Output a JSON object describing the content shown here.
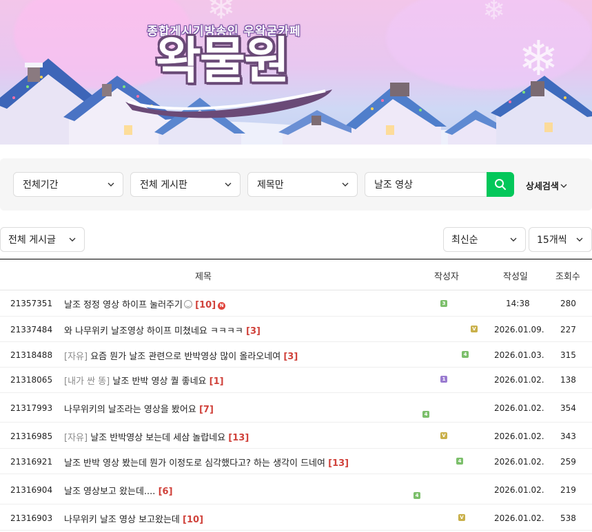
{
  "banner": {
    "tagline": "종합게시기방송인 우왁굳카페",
    "logo_text": "왁물원"
  },
  "search": {
    "period": "전체기간",
    "board": "전체 게시판",
    "scope": "제목만",
    "query": "날조 영상",
    "detail_label": "상세검색"
  },
  "filters": {
    "article_type": "전체 게시글",
    "sort": "최신순",
    "page_size": "15개씩"
  },
  "table": {
    "headers": {
      "title": "제목",
      "author": "작성자",
      "date": "작성일",
      "views": "조회수"
    },
    "rows": [
      {
        "id": "21357351",
        "head": "",
        "title": "날조 정정 영상 하이프 눌러주기",
        "comments": "[10]",
        "badge": "3",
        "badge_color": "#7cbf6b",
        "date": "14:38",
        "views": "280",
        "emoji": true,
        "is_new": true
      },
      {
        "id": "21337484",
        "head": "",
        "title": "와 나무위키 날조영상 하이프 미쳤네요 ㅋㅋㅋㅋ",
        "comments": "[3]",
        "badge": "V",
        "badge_color": "#c9b04a",
        "date": "2026.01.09.",
        "views": "227"
      },
      {
        "id": "21318488",
        "head": "[자유]",
        "title": "요즘 뭔가 날조 관련으로 반박영상 많이 올라오네여",
        "comments": "[3]",
        "badge": "4",
        "badge_color": "#7cbf6b",
        "date": "2026.01.03.",
        "views": "315"
      },
      {
        "id": "21318065",
        "head": "[내가 싼 똥]",
        "title": "날조 반박 영상 퀄 좋네요",
        "comments": "[1]",
        "badge": "1",
        "badge_color": "#9a7bd0",
        "date": "2026.01.02.",
        "views": "138"
      },
      {
        "id": "21317993",
        "head": "",
        "title": "나무위키의 날조라는 영상을 봤어요",
        "comments": "[7]",
        "badge": "4",
        "badge_color": "#7cbf6b",
        "date": "2026.01.02.",
        "views": "354"
      },
      {
        "id": "21316985",
        "head": "[자유]",
        "title": "날조 반박영상 보는데 세삼 놀랍네요",
        "comments": "[13]",
        "badge": "V",
        "badge_color": "#c9b04a",
        "date": "2026.01.02.",
        "views": "343"
      },
      {
        "id": "21316921",
        "head": "",
        "title": "날조 반박 영상 봤는데 뭔가 이정도로 심각했다고? 하는 생각이 드네여",
        "comments": "[13]",
        "badge": "4",
        "badge_color": "#7cbf6b",
        "date": "2026.01.02.",
        "views": "259"
      },
      {
        "id": "21316904",
        "head": "",
        "title": "날조 영상보고 왔는데....",
        "comments": "[6]",
        "badge": "4",
        "badge_color": "#7cbf6b",
        "date": "2026.01.02.",
        "views": "219"
      },
      {
        "id": "21316903",
        "head": "",
        "title": "나무위키 날조 영상 보고왔는데",
        "comments": "[10]",
        "badge": "V",
        "badge_color": "#c9b04a",
        "date": "2026.01.02.",
        "views": "538"
      }
    ]
  },
  "icons": {
    "chevron": "chevron-down-icon",
    "search": "search-icon",
    "new": "new-badge-icon",
    "emoji": "emoticon-icon"
  },
  "colors": {
    "accent": "#03c75a",
    "comment": "#d0423b",
    "head": "#8a8a8a"
  }
}
